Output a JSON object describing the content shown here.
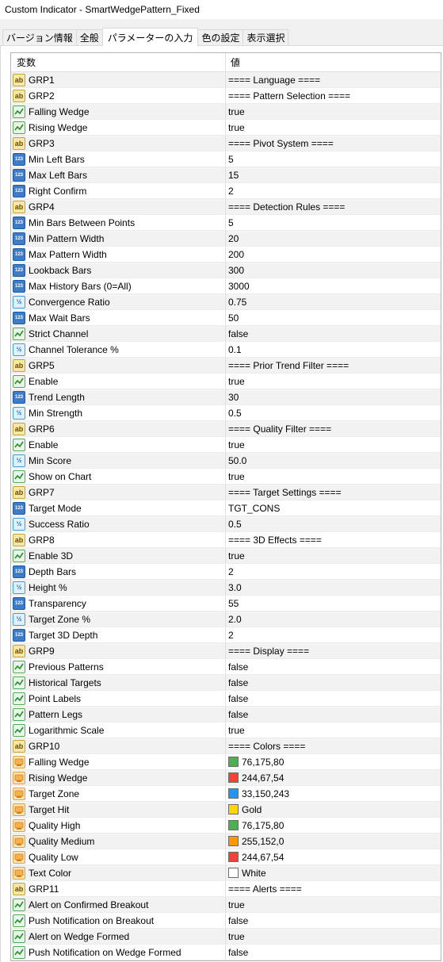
{
  "window": {
    "title": "Custom Indicator - SmartWedgePattern_Fixed"
  },
  "tabs": [
    {
      "label": "バージョン情報",
      "active": false
    },
    {
      "label": "全般",
      "active": false
    },
    {
      "label": "パラメーターの入力",
      "active": true
    },
    {
      "label": "色の設定",
      "active": false
    },
    {
      "label": "表示選択",
      "active": false
    }
  ],
  "grid": {
    "header": {
      "name": "変数",
      "value": "値"
    },
    "rows": [
      {
        "icon": "ab",
        "name": "GRP1",
        "value": "==== Language ===="
      },
      {
        "icon": "ab",
        "name": "GRP2",
        "value": "====  Pattern Selection ===="
      },
      {
        "icon": "bool",
        "name": "Falling Wedge",
        "value": "true"
      },
      {
        "icon": "bool",
        "name": "Rising Wedge",
        "value": "true"
      },
      {
        "icon": "ab",
        "name": "GRP3",
        "value": "====  Pivot System ===="
      },
      {
        "icon": "int",
        "name": "Min Left Bars",
        "value": "5"
      },
      {
        "icon": "int",
        "name": "Max Left Bars",
        "value": "15"
      },
      {
        "icon": "int",
        "name": "Right Confirm",
        "value": "2"
      },
      {
        "icon": "ab",
        "name": "GRP4",
        "value": "==== Detection Rules ===="
      },
      {
        "icon": "int",
        "name": "Min Bars Between Points",
        "value": "5"
      },
      {
        "icon": "int",
        "name": "Min Pattern Width",
        "value": "20"
      },
      {
        "icon": "int",
        "name": "Max Pattern Width",
        "value": "200"
      },
      {
        "icon": "int",
        "name": "Lookback Bars",
        "value": "300"
      },
      {
        "icon": "int",
        "name": "Max History Bars (0=All)",
        "value": "3000"
      },
      {
        "icon": "dbl",
        "name": "Convergence Ratio",
        "value": "0.75"
      },
      {
        "icon": "int",
        "name": "Max Wait Bars",
        "value": "50"
      },
      {
        "icon": "bool",
        "name": "Strict Channel",
        "value": "false"
      },
      {
        "icon": "dbl",
        "name": "Channel Tolerance %",
        "value": "0.1"
      },
      {
        "icon": "ab",
        "name": "GRP5",
        "value": "====  Prior Trend Filter ===="
      },
      {
        "icon": "bool",
        "name": "Enable",
        "value": "true"
      },
      {
        "icon": "int",
        "name": "Trend Length",
        "value": "30"
      },
      {
        "icon": "dbl",
        "name": "Min Strength",
        "value": "0.5"
      },
      {
        "icon": "ab",
        "name": "GRP6",
        "value": "==== Quality Filter ===="
      },
      {
        "icon": "bool",
        "name": "Enable",
        "value": "true"
      },
      {
        "icon": "dbl",
        "name": "Min Score",
        "value": "50.0"
      },
      {
        "icon": "bool",
        "name": "Show on Chart",
        "value": "true"
      },
      {
        "icon": "ab",
        "name": "GRP7",
        "value": "==== Target Settings ===="
      },
      {
        "icon": "int",
        "name": "Target Mode",
        "value": "TGT_CONS"
      },
      {
        "icon": "dbl",
        "name": "Success Ratio",
        "value": "0.5"
      },
      {
        "icon": "ab",
        "name": "GRP8",
        "value": "==== 3D Effects ===="
      },
      {
        "icon": "bool",
        "name": "Enable 3D",
        "value": "true"
      },
      {
        "icon": "int",
        "name": "Depth Bars",
        "value": "2"
      },
      {
        "icon": "dbl",
        "name": "Height %",
        "value": "3.0"
      },
      {
        "icon": "int",
        "name": "Transparency",
        "value": "55"
      },
      {
        "icon": "dbl",
        "name": "Target Zone %",
        "value": "2.0"
      },
      {
        "icon": "int",
        "name": "Target 3D Depth",
        "value": "2"
      },
      {
        "icon": "ab",
        "name": "GRP9",
        "value": "==== Display ===="
      },
      {
        "icon": "bool",
        "name": "Previous Patterns",
        "value": "false"
      },
      {
        "icon": "bool",
        "name": "Historical Targets",
        "value": "false"
      },
      {
        "icon": "bool",
        "name": "Point Labels",
        "value": "false"
      },
      {
        "icon": "bool",
        "name": "Pattern Legs",
        "value": "false"
      },
      {
        "icon": "bool",
        "name": "Logarithmic Scale",
        "value": "true"
      },
      {
        "icon": "ab",
        "name": "GRP10",
        "value": "==== Colors ===="
      },
      {
        "icon": "color",
        "name": "Falling Wedge",
        "value": "76,175,80",
        "swatch": "#4caf50"
      },
      {
        "icon": "color",
        "name": "Rising Wedge",
        "value": "244,67,54",
        "swatch": "#f44336"
      },
      {
        "icon": "color",
        "name": "Target Zone",
        "value": "33,150,243",
        "swatch": "#2196f3"
      },
      {
        "icon": "color",
        "name": "Target Hit",
        "value": "Gold",
        "swatch": "#ffd700"
      },
      {
        "icon": "color",
        "name": "Quality High",
        "value": "76,175,80",
        "swatch": "#4caf50"
      },
      {
        "icon": "color",
        "name": "Quality Medium",
        "value": "255,152,0",
        "swatch": "#ff9800"
      },
      {
        "icon": "color",
        "name": "Quality Low",
        "value": "244,67,54",
        "swatch": "#f44336"
      },
      {
        "icon": "color",
        "name": "Text Color",
        "value": "White",
        "swatch": "#ffffff"
      },
      {
        "icon": "ab",
        "name": "GRP11",
        "value": "==== Alerts ===="
      },
      {
        "icon": "bool",
        "name": "Alert on Confirmed Breakout",
        "value": "true"
      },
      {
        "icon": "bool",
        "name": "Push Notification on Breakout",
        "value": "false"
      },
      {
        "icon": "bool",
        "name": "Alert on Wedge Formed",
        "value": "true"
      },
      {
        "icon": "bool",
        "name": "Push Notification on Wedge Formed",
        "value": "false"
      }
    ]
  }
}
